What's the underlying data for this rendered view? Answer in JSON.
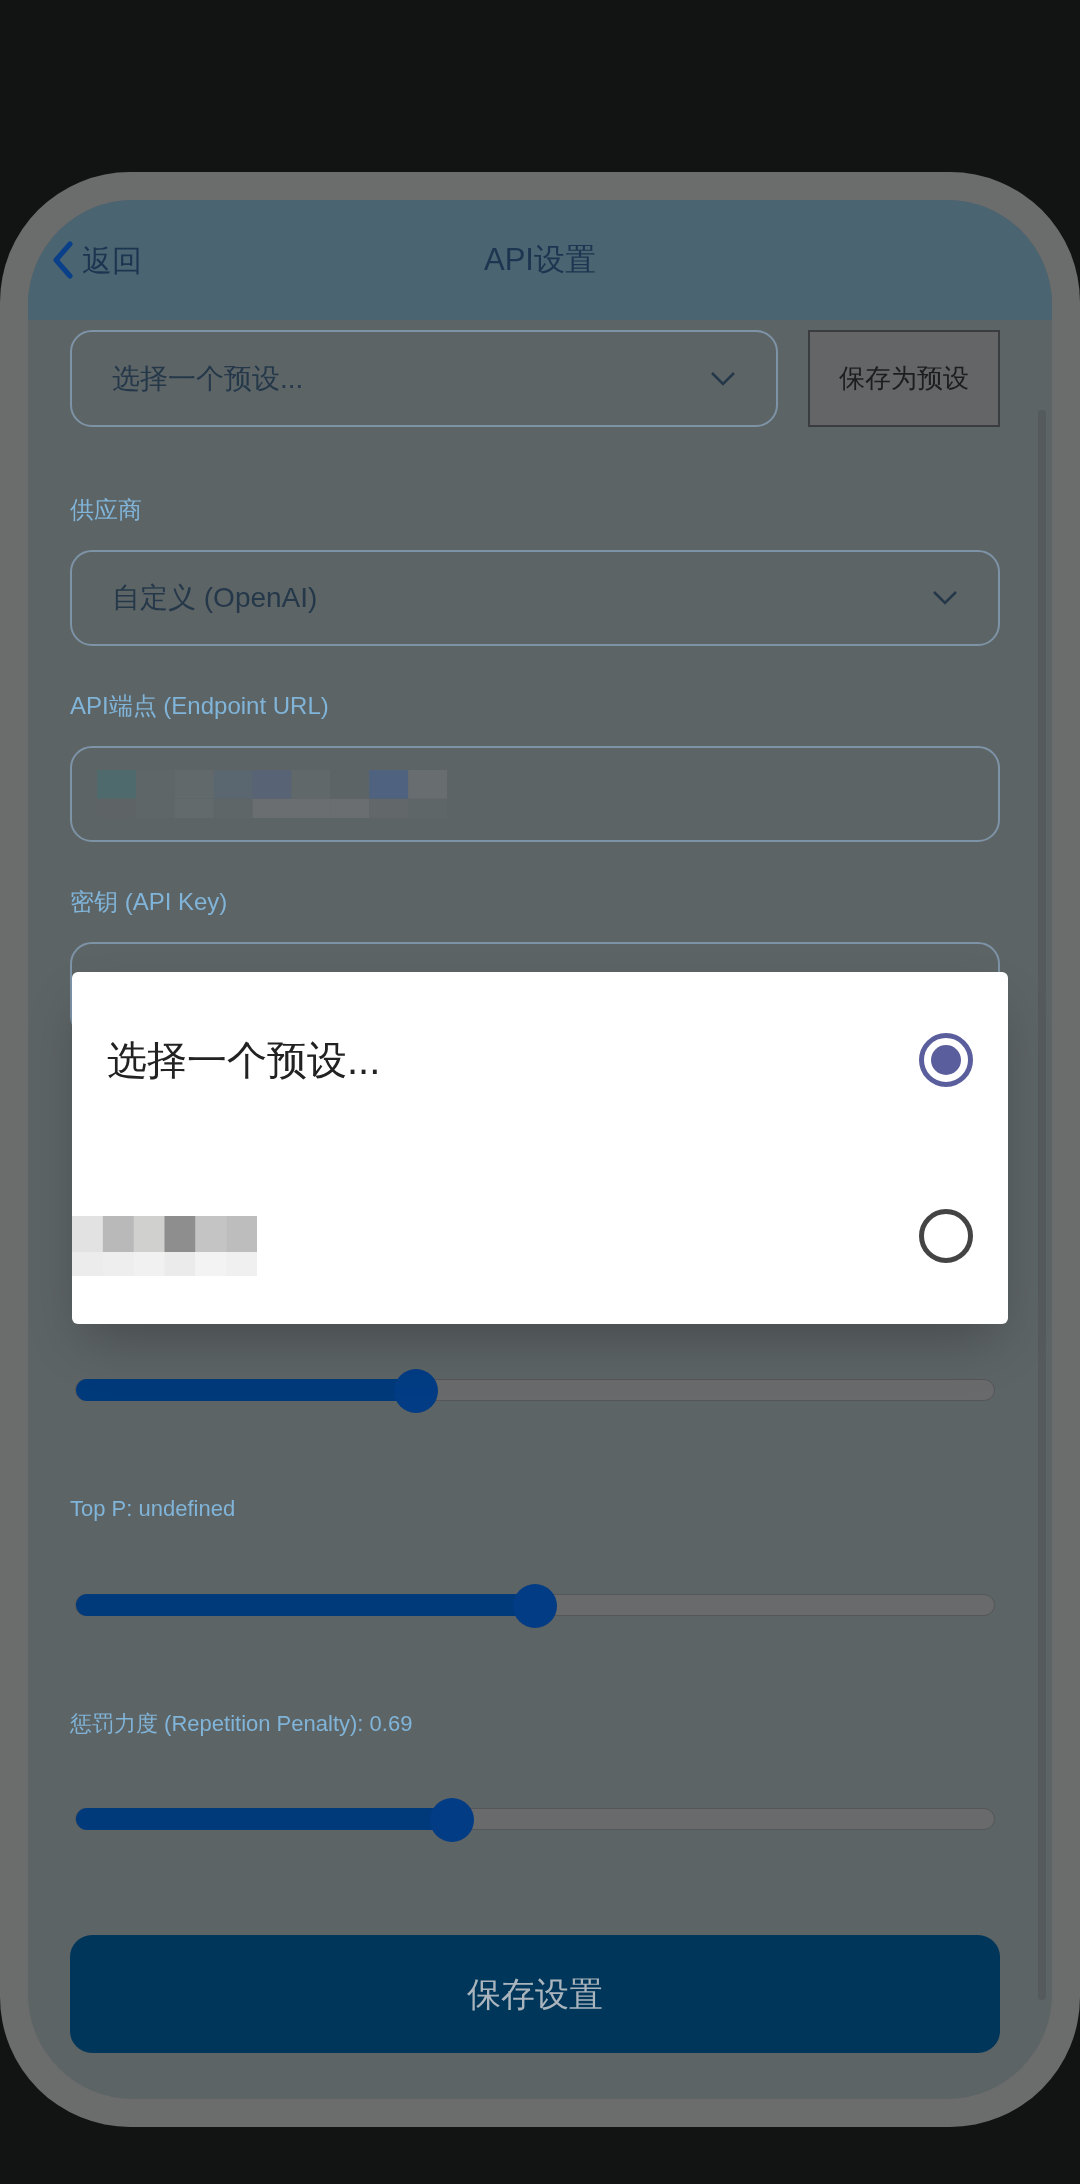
{
  "header": {
    "back": "返回",
    "title": "API设置"
  },
  "preset": {
    "value": "选择一个预设...",
    "save_button": "保存为预设"
  },
  "fields": [
    {
      "kind": "select",
      "label": "供应商",
      "value": "自定义 (OpenAI)"
    },
    {
      "kind": "redacted",
      "label": "API端点 (Endpoint URL)"
    },
    {
      "kind": "input",
      "label": "密钥 (API Key)"
    }
  ],
  "sliders": [
    {
      "level": 0.37
    },
    {
      "label": "Top P: undefined",
      "level": 0.5
    },
    {
      "label": "惩罚力度 (Repetition Penalty): 0.69",
      "level": 0.41
    }
  ],
  "save_button": "保存设置",
  "dialog": {
    "options": [
      {
        "kind": "text",
        "label": "选择一个预设...",
        "selected": true
      },
      {
        "kind": "redacted",
        "selected": false
      }
    ]
  }
}
